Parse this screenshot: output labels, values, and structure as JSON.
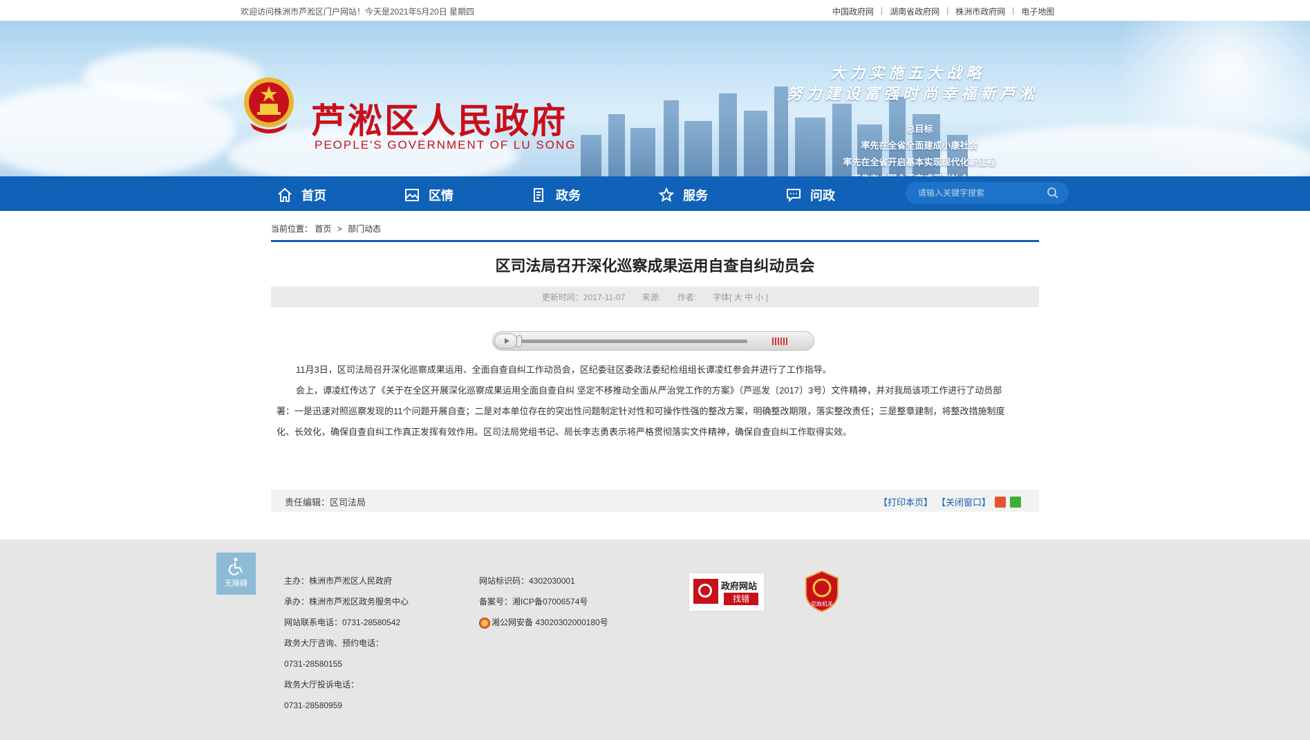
{
  "topbar": {
    "welcome": "欢迎访问株洲市芦淞区门户网站！今天是2021年5月20日 星期四",
    "links": [
      "中国政府网",
      "湖南省政府网",
      "株洲市政府网",
      "电子地图"
    ]
  },
  "banner": {
    "title": "芦淞区人民政府",
    "subtitle": "PEOPLE'S GOVERNMENT OF  LU SONG",
    "slogan_line1": "大力实施五大战略",
    "slogan_line2": "努力建设富强时尚幸福新芦淞",
    "goals_heading": "总目标",
    "goals": [
      "率先在全省全面建成小康社会",
      "率先在全省开启基本实现现代化新征程",
      "率先在全国全面完成两型社会建设"
    ]
  },
  "nav": {
    "items": [
      "首页",
      "区情",
      "政务",
      "服务",
      "问政"
    ],
    "search_placeholder": "请输入关键字搜索"
  },
  "breadcrumb": {
    "prefix": "当前位置：",
    "items": [
      "首页",
      "部门动态"
    ],
    "separator": ">"
  },
  "article": {
    "title": "区司法局召开深化巡察成果运用自查自纠动员会",
    "meta": {
      "updated": "更新时间：2017-11-07",
      "source": "来源:",
      "author": "作者:",
      "font": "字体[ 大 中 小 ]"
    },
    "paragraphs": [
      "11月3日，区司法局召开深化巡察成果运用、全面自查自纠工作动员会，区纪委驻区委政法委纪检组组长谭凌红参会并进行了工作指导。",
      "会上，谭凌红传达了《关于在全区开展深化巡察成果运用全面自查自纠 坚定不移推动全面从严治党工作的方案》（芦巡发〔2017〕3号）文件精神，并对我局该项工作进行了动员部署：一是迅速对照巡察发现的11个问题开展自查；二是对本单位存在的突出性问题制定针对性和可操作性强的整改方案，明确整改期限，落实整改责任；三是整章建制，将整改措施制度化、长效化，确保自查自纠工作真正发挥有效作用。区司法局党组书记、局长李志勇表示将严格贯彻落实文件精神，确保自查自纠工作取得实效。"
    ],
    "editor": "责任编辑：区司法局",
    "print": "【打印本页】",
    "close": "【关闭窗口】"
  },
  "footer": {
    "accessibility": "无障碍",
    "col1": [
      "主办：株洲市芦淞区人民政府",
      "承办：株洲市芦淞区政务服务中心",
      "网站联系电话：0731-28580542",
      "政务大厅咨询、预约电话：",
      "0731-28580155",
      "政务大厅投诉电话：",
      "0731-28580959"
    ],
    "col2": [
      "网站标识码：4302030001",
      "备案号：湘ICP备07006574号",
      "湘公网安备 43020302000180号"
    ],
    "zhaocuo_t1": "政府网站",
    "zhaocuo_t2": "找错",
    "party_label": "党政机关"
  },
  "colors": {
    "brand_blue": "#0f62b8",
    "brand_red": "#c8101a"
  }
}
